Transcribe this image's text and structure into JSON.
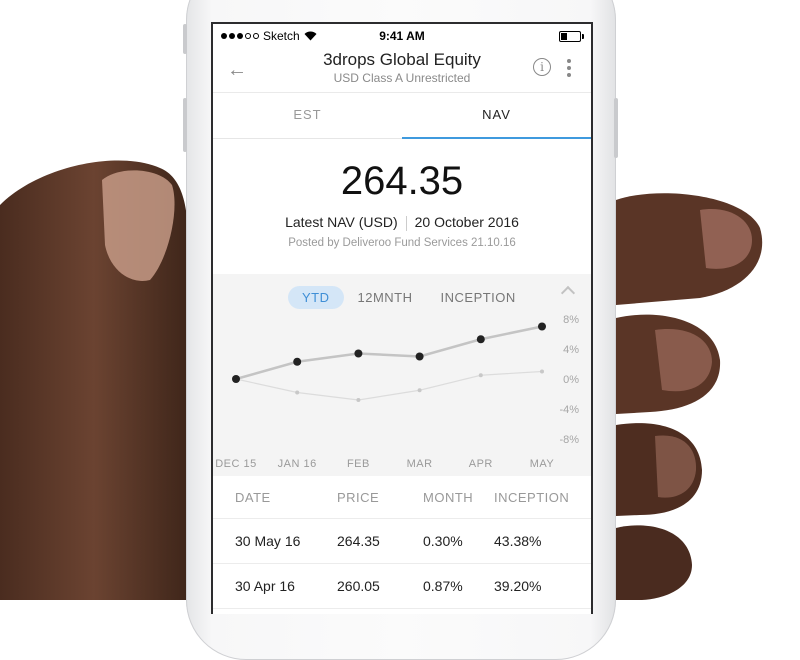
{
  "status_bar": {
    "carrier": "Sketch",
    "time": "9:41 AM"
  },
  "header": {
    "title": "3drops Global Equity",
    "subtitle": "USD Class A Unrestricted"
  },
  "tabs": [
    {
      "label": "EST",
      "active": false
    },
    {
      "label": "NAV",
      "active": true
    }
  ],
  "nav": {
    "value": "264.35",
    "label": "Latest NAV (USD)",
    "date": "20 October 2016",
    "posted": "Posted by Deliveroo Fund Services 21.10.16"
  },
  "range_tabs": [
    {
      "label": "YTD",
      "active": true
    },
    {
      "label": "12MNTH",
      "active": false
    },
    {
      "label": "INCEPTION",
      "active": false
    }
  ],
  "chart_data": {
    "type": "line",
    "categories": [
      "DEC 15",
      "JAN 16",
      "FEB",
      "MAR",
      "APR",
      "MAY"
    ],
    "y_ticks": [
      "8%",
      "4%",
      "0%",
      "-4%",
      "-8%"
    ],
    "ylim": [
      -8,
      8
    ],
    "grid": false,
    "series": [
      {
        "values": [
          0,
          2.3,
          3.4,
          3.0,
          5.3,
          7.0
        ],
        "color": "#c4c4c4",
        "marker_color": "#222222"
      },
      {
        "values": [
          0,
          -1.8,
          -2.8,
          -1.5,
          0.5,
          1.0
        ],
        "color": "#dcdcdc",
        "marker_color": "#c8c8c8"
      }
    ]
  },
  "table": {
    "headers": {
      "date": "DATE",
      "price": "PRICE",
      "month": "MONTH",
      "inception": "INCEPTION"
    },
    "rows": [
      {
        "date": "30 May",
        "year": "16",
        "price": "264.35",
        "month": "0.30%",
        "inception": "43.38%"
      },
      {
        "date": "30 Apr",
        "year": "16",
        "price": "260.05",
        "month": "0.87%",
        "inception": "39.20%"
      }
    ]
  },
  "colors": {
    "accent": "#3f9ade",
    "active_pill_bg": "#d4e6f7",
    "chart_bg": "#f4f4f4"
  }
}
